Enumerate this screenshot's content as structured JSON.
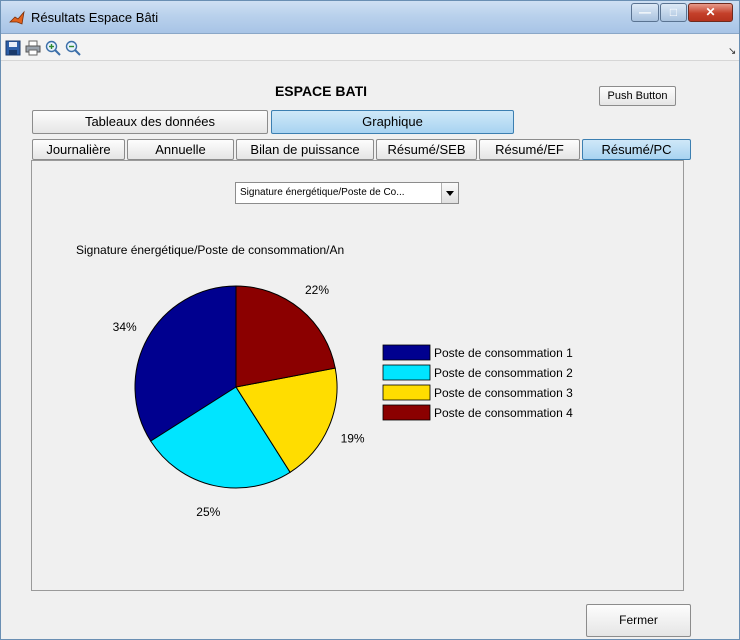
{
  "window": {
    "title": "Résultats Espace Bâti"
  },
  "toolbar": {
    "icons": [
      "save-icon",
      "print-icon",
      "zoom-in-icon",
      "zoom-out-icon"
    ]
  },
  "heading": "ESPACE BATI",
  "push_button": "Push Button",
  "main_tabs": [
    {
      "label": "Tableaux des données",
      "active": false
    },
    {
      "label": "Graphique",
      "active": true
    }
  ],
  "sub_tabs": [
    {
      "label": "Journalière",
      "active": false
    },
    {
      "label": "Annuelle",
      "active": false
    },
    {
      "label": "Bilan de puissance",
      "active": false
    },
    {
      "label": "Résumé/SEB",
      "active": false
    },
    {
      "label": "Résumé/EF",
      "active": false
    },
    {
      "label": "Résumé/PC",
      "active": true
    }
  ],
  "dropdown": {
    "selected": "Signature énergétique/Poste de Co..."
  },
  "chart_data": {
    "type": "pie",
    "title": "Signature énergétique/Poste de consommation/An",
    "slices": [
      {
        "label": "Poste de consommation 1",
        "value": 34,
        "display": "34%",
        "color": "#00008f"
      },
      {
        "label": "Poste de consommation 2",
        "value": 25,
        "display": "25%",
        "color": "#00e5ff"
      },
      {
        "label": "Poste de consommation 3",
        "value": 19,
        "display": "19%",
        "color": "#ffdd00"
      },
      {
        "label": "Poste de consommation 4",
        "value": 22,
        "display": "22%",
        "color": "#8b0000"
      }
    ],
    "legend_position": "right"
  },
  "close_button": "Fermer",
  "colors": {
    "active_tab": "#a8d3f1",
    "window_border": "#6a8fb3"
  }
}
